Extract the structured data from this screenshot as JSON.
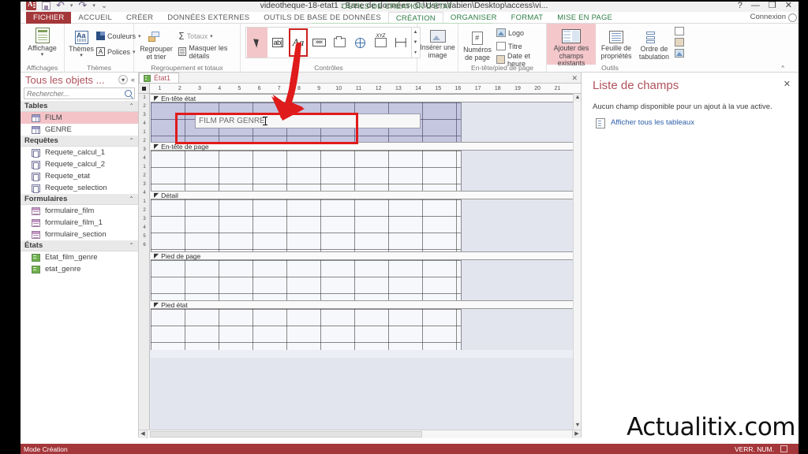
{
  "window": {
    "document_title": "videotheque-18-etat1 : Base de données- C:\\Users\\fabien\\Desktop\\access\\vi...",
    "contextual_tab_group": "OUTILS DE CRÉATION D'ÉTAT",
    "help": "?",
    "minimize": "—",
    "restore": "❐",
    "close": "✕",
    "connexion": "Connexion",
    "quick_access": [
      "access-app-icon",
      "save-icon",
      "undo-icon",
      "redo-icon",
      "customize-qat-icon"
    ]
  },
  "tabs": [
    {
      "label": "FICHIER",
      "type": "file"
    },
    {
      "label": "ACCUEIL",
      "type": "normal"
    },
    {
      "label": "CRÉER",
      "type": "normal"
    },
    {
      "label": "DONNÉES EXTERNES",
      "type": "normal"
    },
    {
      "label": "OUTILS DE BASE DE DONNÉES",
      "type": "normal"
    },
    {
      "label": "CRÉATION",
      "type": "active"
    },
    {
      "label": "ORGANISER",
      "type": "ctx"
    },
    {
      "label": "FORMAT",
      "type": "ctx"
    },
    {
      "label": "MISE EN PAGE",
      "type": "ctx"
    }
  ],
  "ribbon": {
    "groups": [
      {
        "label": "Affichages",
        "buttons": [
          {
            "label": "Affichage",
            "icon": "view-icon",
            "caret": "▾"
          }
        ]
      },
      {
        "label": "Thèmes",
        "buttons": [
          {
            "label": "Thèmes",
            "icon": "themes-icon",
            "caret": "▾"
          },
          {
            "label": "Couleurs",
            "icon": "colors-icon",
            "caret": "▾"
          },
          {
            "label": "Polices",
            "icon": "fonts-icon",
            "caret": "▾"
          }
        ]
      },
      {
        "label": "Regroupement et totaux",
        "buttons": [
          {
            "label": "Regrouper et trier",
            "icon": "group-sort-icon"
          },
          {
            "label": "Totaux",
            "icon": "sum-icon",
            "caret": "▾"
          },
          {
            "label": "Masquer les détails",
            "icon": "hide-details-icon"
          }
        ]
      },
      {
        "label": "Contrôles",
        "controls": [
          {
            "name": "select-tool",
            "glyph": "arrow",
            "state": "selected"
          },
          {
            "name": "label-tool",
            "glyph": "ab|",
            "state": "normal"
          },
          {
            "name": "text-format-tool",
            "glyph": "Aa",
            "state": "highlighted"
          },
          {
            "name": "text-box-tool",
            "glyph": "xxxx",
            "state": "normal"
          },
          {
            "name": "group-box-tool",
            "glyph": "group",
            "state": "normal"
          },
          {
            "name": "hyperlink-tool",
            "glyph": "globe",
            "state": "normal"
          },
          {
            "name": "page-break-tool",
            "glyph": "XYZ",
            "state": "normal"
          },
          {
            "name": "line-tool",
            "glyph": "line",
            "state": "normal"
          }
        ]
      },
      {
        "label": "",
        "buttons": [
          {
            "label": "Insérer une image",
            "icon": "insert-image-icon",
            "caret": "▾"
          }
        ]
      },
      {
        "label": "En-tête/pied de page",
        "buttons": [
          {
            "label": "Numéros de page",
            "icon": "page-numbers-icon"
          },
          {
            "label": "Logo",
            "icon": "logo-icon"
          },
          {
            "label": "Titre",
            "icon": "title-icon"
          },
          {
            "label": "Date et heure",
            "icon": "date-time-icon"
          }
        ]
      },
      {
        "label": "Outils",
        "buttons": [
          {
            "label": "Ajouter des champs existants",
            "icon": "add-existing-fields-icon",
            "state": "highlighted"
          },
          {
            "label": "Feuille de propriétés",
            "icon": "property-sheet-icon"
          },
          {
            "label": "Ordre de tabulation",
            "icon": "tab-order-icon"
          },
          {
            "label": "",
            "icon": "subreport-icon"
          }
        ]
      }
    ],
    "collapse_caret": "^"
  },
  "nav_pane": {
    "title": "Tous les objets ...",
    "menu_icon": "chevron-down-circle-icon",
    "collapse_icon": "double-chevron-left-icon",
    "search_placeholder": "Rechercher...",
    "search_value": "",
    "groups": [
      {
        "label": "Tables",
        "collapse": "⌃",
        "items": [
          {
            "label": "FILM",
            "icon": "table-icon",
            "selected": true
          },
          {
            "label": "GENRE",
            "icon": "table-icon",
            "selected": false
          }
        ]
      },
      {
        "label": "Requêtes",
        "collapse": "⌃",
        "items": [
          {
            "label": "Requete_calcul_1",
            "icon": "query-icon",
            "selected": false
          },
          {
            "label": "Requete_calcul_2",
            "icon": "query-icon",
            "selected": false
          },
          {
            "label": "Requete_etat",
            "icon": "query-icon",
            "selected": false
          },
          {
            "label": "Requete_selection",
            "icon": "query-icon",
            "selected": false
          }
        ]
      },
      {
        "label": "Formulaires",
        "collapse": "⌃",
        "items": [
          {
            "label": "formulaire_film",
            "icon": "form-icon",
            "selected": false
          },
          {
            "label": "formulaire_film_1",
            "icon": "form-icon",
            "selected": false
          },
          {
            "label": "formulaire_section",
            "icon": "form-icon",
            "selected": false
          }
        ]
      },
      {
        "label": "États",
        "collapse": "⌃",
        "items": [
          {
            "label": "Etat_film_genre",
            "icon": "report-icon",
            "selected": false
          },
          {
            "label": "etat_genre",
            "icon": "report-icon",
            "selected": false
          }
        ]
      }
    ]
  },
  "designer": {
    "tab_label": "État1",
    "tab_icon": "report-icon",
    "ruler_h_ticks": [
      "1",
      "2",
      "3",
      "4",
      "5",
      "6",
      "7",
      "8",
      "9",
      "10",
      "11",
      "12",
      "13",
      "14",
      "15",
      "16",
      "17",
      "18",
      "19",
      "20",
      "21"
    ],
    "ruler_v_ticks": [
      "1",
      "2",
      "3",
      "4",
      "1",
      "2",
      "3",
      "4",
      "1",
      "2",
      "3",
      "4",
      "1",
      "2",
      "3",
      "4",
      "5",
      "6"
    ],
    "sections": [
      {
        "label": "En-tête état",
        "caret": "◤",
        "selected": true
      },
      {
        "label": "En-tête de page",
        "caret": "◤",
        "selected": false
      },
      {
        "label": "Détail",
        "caret": "◤",
        "selected": false
      },
      {
        "label": "Pied de page",
        "caret": "◤",
        "selected": false
      },
      {
        "label": "Pied état",
        "caret": "◤",
        "selected": false
      }
    ],
    "title_control_text": "FILM PAR GENRE",
    "annotation": {
      "shape": "red-arrow-and-rectangle",
      "color": "#e01b1b"
    }
  },
  "task_pane": {
    "title": "Liste de champs",
    "close": "✕",
    "message": "Aucun champ disponible pour un ajout à la vue active.",
    "link": "Afficher tous les tableaux",
    "link_icon": "all-tables-icon"
  },
  "status_bar": {
    "mode": "Mode Création",
    "num_lock": "VERR. NUM.",
    "view_icon": "design-view-icon"
  },
  "watermark": "Actualitix.com",
  "colors": {
    "accent": "#a4373a",
    "ctx_green": "#2e7d46",
    "highlight_pink": "#f3c3c8",
    "annotation_red": "#e01b1b"
  }
}
